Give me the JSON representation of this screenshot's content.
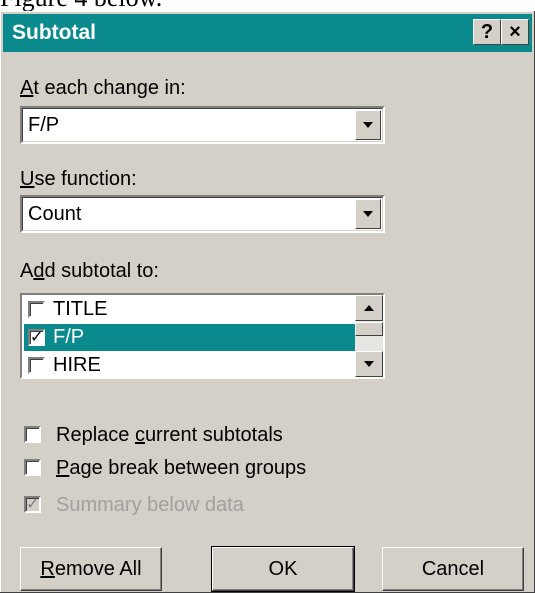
{
  "doc_caption": "Figure 4 below.",
  "dialog": {
    "title": "Subtotal",
    "help_button": "?",
    "close_button": "×"
  },
  "at_each_change": {
    "label_accel": "A",
    "label_rest": "t each change in:",
    "value": "F/P"
  },
  "use_function": {
    "label_accel": "U",
    "label_rest": "se function:",
    "value": "Count"
  },
  "add_subtotal": {
    "label_pre": "A",
    "label_accel": "d",
    "label_rest": "d subtotal to:",
    "items": [
      {
        "label": "TITLE",
        "checked": false
      },
      {
        "label": "F/P",
        "checked": true,
        "selected": true
      },
      {
        "label": "HIRE",
        "checked": false
      }
    ]
  },
  "options": {
    "replace_pre": "Replace ",
    "replace_accel": "c",
    "replace_rest": "urrent subtotals",
    "page_break_accel": "P",
    "page_break_rest": "age break between groups",
    "summary_below": "Summary below data"
  },
  "buttons": {
    "remove_accel": "R",
    "remove_rest": "emove All",
    "ok": "OK",
    "cancel": "Cancel"
  },
  "colors": {
    "titlebar": "#0a8a8c",
    "selection": "#0a8a8c",
    "face": "#d4d0c8"
  }
}
